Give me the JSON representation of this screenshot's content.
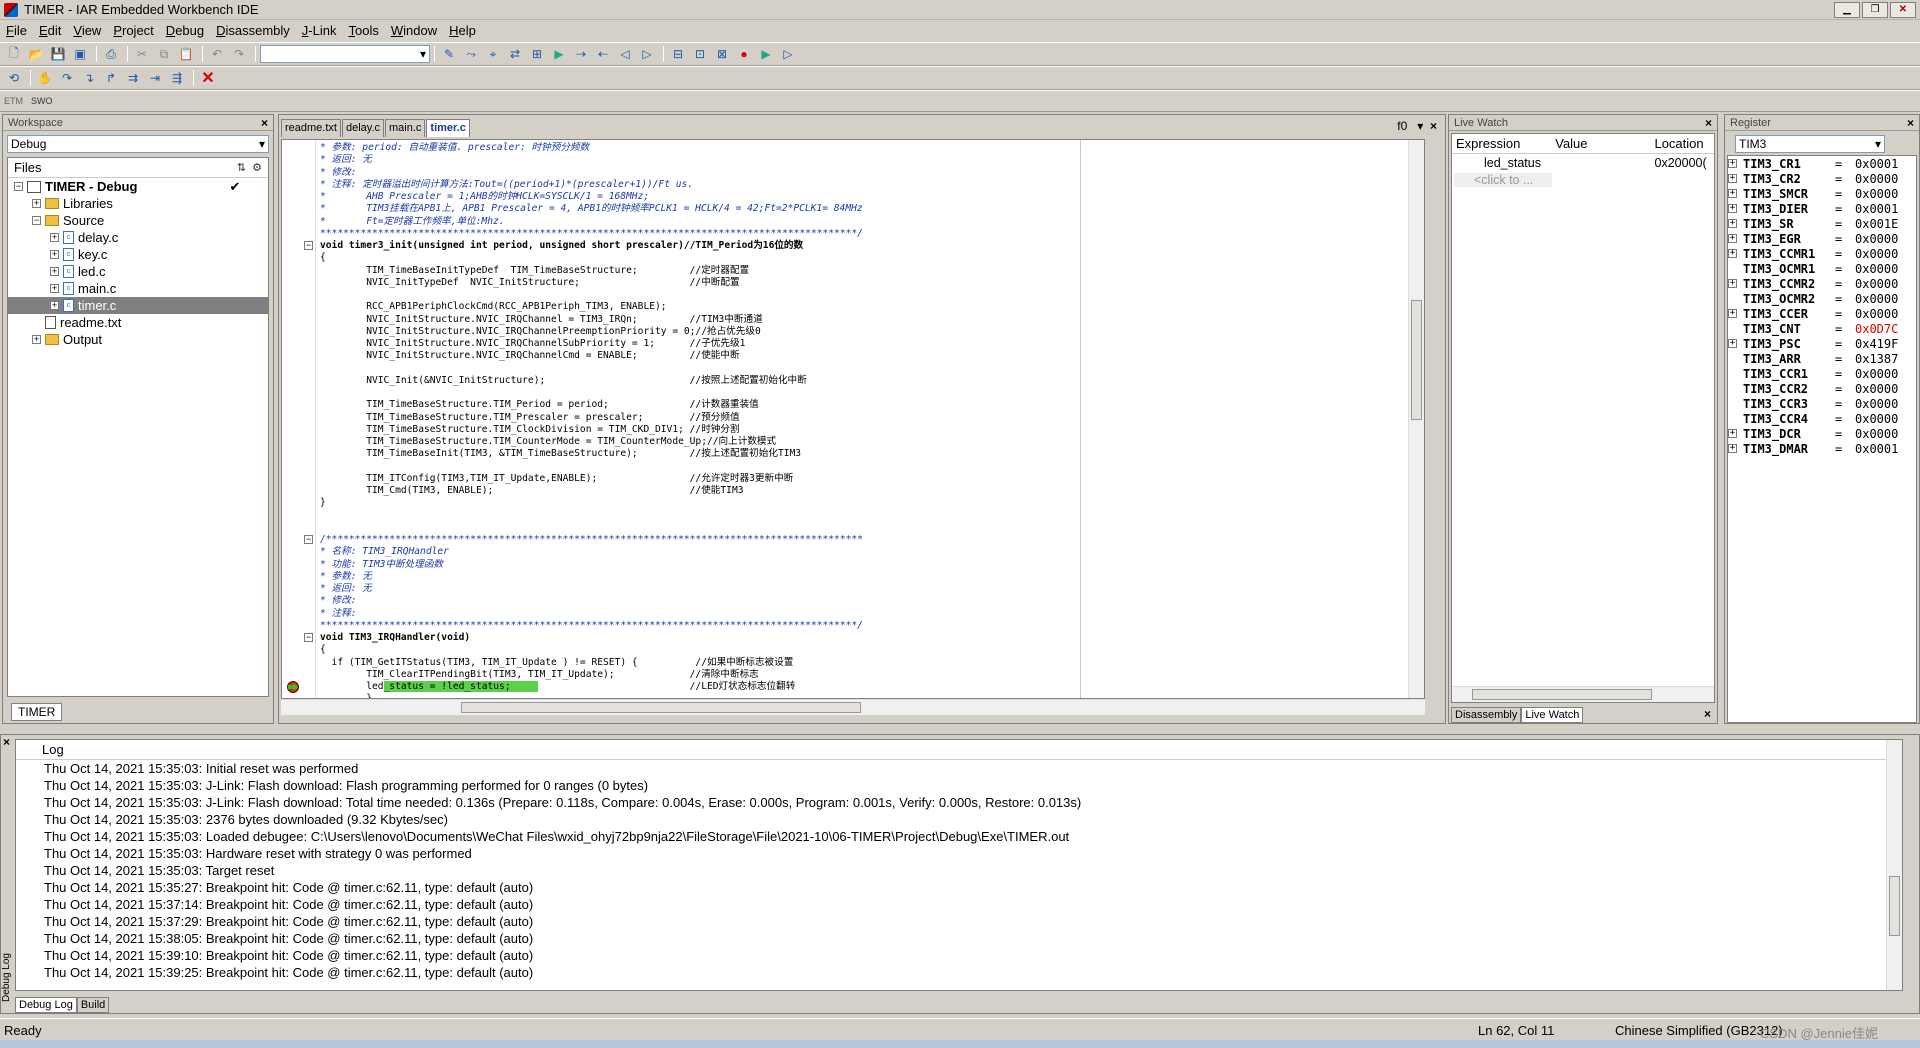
{
  "window": {
    "title": "TIMER - IAR Embedded Workbench IDE",
    "min": "▁",
    "max": "❐",
    "close": "✕"
  },
  "menu": [
    "File",
    "Edit",
    "View",
    "Project",
    "Debug",
    "Disassembly",
    "J-Link",
    "Tools",
    "Window",
    "Help"
  ],
  "toolbar_icons": [
    "new-file-icon",
    "open-file-icon",
    "save-icon",
    "save-all-icon",
    "print-icon",
    "cut-icon",
    "copy-icon",
    "paste-icon",
    "undo-icon",
    "redo-icon"
  ],
  "toolbar3_labels": {
    "etm": "ETM",
    "swo": "SWO"
  },
  "workspace": {
    "title": "Workspace",
    "close": "×",
    "config": "Debug",
    "files_header": "Files",
    "tree": [
      {
        "label": "TIMER - Debug",
        "level": 0,
        "type": "project",
        "bold": true
      },
      {
        "label": "Libraries",
        "level": 1,
        "type": "folder"
      },
      {
        "label": "Source",
        "level": 1,
        "type": "folder"
      },
      {
        "label": "delay.c",
        "level": 2,
        "type": "c"
      },
      {
        "label": "key.c",
        "level": 2,
        "type": "c"
      },
      {
        "label": "led.c",
        "level": 2,
        "type": "c"
      },
      {
        "label": "main.c",
        "level": 2,
        "type": "c"
      },
      {
        "label": "timer.c",
        "level": 2,
        "type": "c",
        "selected": true
      },
      {
        "label": "readme.txt",
        "level": 1,
        "type": "txt"
      },
      {
        "label": "Output",
        "level": 1,
        "type": "folder"
      }
    ],
    "tab": "TIMER"
  },
  "editor": {
    "tabs": [
      "readme.txt",
      "delay.c",
      "main.c",
      "timer.c"
    ],
    "active_tab": "timer.c",
    "func_label": "f0",
    "lines": [
      {
        "t": "* 参数: period: 自动重装值. prescaler: 时钟预分频数",
        "c": "cmt"
      },
      {
        "t": "* 返回: 无",
        "c": "cmt"
      },
      {
        "t": "* 修改:",
        "c": "cmt"
      },
      {
        "t": "* 注释: 定时器溢出时间计算方法:Tout=((period+1)*(prescaler+1))/Ft us.",
        "c": "cmt"
      },
      {
        "t": "*       AHB Prescaler = 1;AHB的时钟HCLK=SYSCLK/1 = 168MHz;",
        "c": "cmt"
      },
      {
        "t": "*       TIM3挂载在APB1上, APB1 Prescaler = 4, APB1的时钟频率PCLK1 = HCLK/4 = 42;Ft=2*PCLK1= 84MHz",
        "c": "cmt"
      },
      {
        "t": "*       Ft=定时器工作频率,单位:Mhz.",
        "c": "cmt"
      },
      {
        "t": "*********************************************************************************************/",
        "c": "cmt"
      },
      {
        "t": "void timer3_init(unsigned int period, unsigned short prescaler)//TIM_Period为16位的数",
        "c": "fn"
      },
      {
        "t": "{",
        "c": ""
      },
      {
        "t": "        TIM_TimeBaseInitTypeDef  TIM_TimeBaseStructure;         //定时器配置",
        "c": "mix"
      },
      {
        "t": "        NVIC_InitTypeDef  NVIC_InitStructure;                   //中断配置",
        "c": "mix"
      },
      {
        "t": "",
        "c": ""
      },
      {
        "t": "        RCC_APB1PeriphClockCmd(RCC_APB1Periph_TIM3, ENABLE);",
        "c": ""
      },
      {
        "t": "        NVIC_InitStructure.NVIC_IRQChannel = TIM3_IRQn;         //TIM3中断通道",
        "c": "mix"
      },
      {
        "t": "        NVIC_InitStructure.NVIC_IRQChannelPreemptionPriority = 0;//抢占优先级0",
        "c": "mix"
      },
      {
        "t": "        NVIC_InitStructure.NVIC_IRQChannelSubPriority = 1;      //子优先级1",
        "c": "mix"
      },
      {
        "t": "        NVIC_InitStructure.NVIC_IRQChannelCmd = ENABLE;         //使能中断",
        "c": "mix"
      },
      {
        "t": "",
        "c": ""
      },
      {
        "t": "        NVIC_Init(&NVIC_InitStructure);                         //按照上述配置初始化中断",
        "c": "mix"
      },
      {
        "t": "",
        "c": ""
      },
      {
        "t": "        TIM_TimeBaseStructure.TIM_Period = period;              //计数器重装值",
        "c": "mix"
      },
      {
        "t": "        TIM_TimeBaseStructure.TIM_Prescaler = prescaler;        //预分频值",
        "c": "mix"
      },
      {
        "t": "        TIM_TimeBaseStructure.TIM_ClockDivision = TIM_CKD_DIV1; //时钟分割",
        "c": "mix"
      },
      {
        "t": "        TIM_TimeBaseStructure.TIM_CounterMode = TIM_CounterMode_Up;//向上计数模式",
        "c": "mix"
      },
      {
        "t": "        TIM_TimeBaseInit(TIM3, &TIM_TimeBaseStructure);         //按上述配置初始化TIM3",
        "c": "mix"
      },
      {
        "t": "",
        "c": ""
      },
      {
        "t": "        TIM_ITConfig(TIM3,TIM_IT_Update,ENABLE);                //允许定时器3更新中断",
        "c": "mix"
      },
      {
        "t": "        TIM_Cmd(TIM3, ENABLE);                                  //使能TIM3",
        "c": "mix"
      },
      {
        "t": "}",
        "c": ""
      },
      {
        "t": "",
        "c": ""
      },
      {
        "t": "",
        "c": ""
      },
      {
        "t": "/*********************************************************************************************",
        "c": "cmt"
      },
      {
        "t": "* 名称: TIM3_IRQHandler",
        "c": "cmt"
      },
      {
        "t": "* 功能: TIM3中断处理函数",
        "c": "cmt"
      },
      {
        "t": "* 参数: 无",
        "c": "cmt"
      },
      {
        "t": "* 返回: 无",
        "c": "cmt"
      },
      {
        "t": "* 修改:",
        "c": "cmt"
      },
      {
        "t": "* 注释:",
        "c": "cmt"
      },
      {
        "t": "*********************************************************************************************/",
        "c": "cmt"
      },
      {
        "t": "void TIM3_IRQHandler(void)",
        "c": "fn"
      },
      {
        "t": "{",
        "c": ""
      },
      {
        "t": "  if (TIM_GetITStatus(TIM3, TIM_IT_Update ) != RESET) {          //如果中断标志被设置",
        "c": "mix"
      },
      {
        "t": "        TIM_ClearITPendingBit(TIM3, TIM_IT_Update);             //清除中断标志",
        "c": "mix"
      },
      {
        "t": "        led_status = !led_status;                               //LED灯状态标志位翻转",
        "c": "hl"
      },
      {
        "t": "        }",
        "c": ""
      },
      {
        "t": "",
        "c": ""
      },
      {
        "t": "}",
        "c": ""
      }
    ]
  },
  "livewatch": {
    "title": "Live Watch",
    "close": "×",
    "columns": [
      "Expression",
      "Value",
      "Location"
    ],
    "rows": [
      {
        "expr": "led_status",
        "value": "",
        "loc": "0x20000("
      },
      {
        "expr": "<click to ...",
        "value": "",
        "loc": ""
      }
    ],
    "tabs": [
      "Disassembly",
      "Live Watch"
    ],
    "active_tab": "Live Watch",
    "tab_close": "×"
  },
  "register": {
    "title": "Register",
    "close": "×",
    "selected": "TIM3",
    "rows": [
      {
        "name": "TIM3_CR1",
        "value": "0x0001",
        "expand": true
      },
      {
        "name": "TIM3_CR2",
        "value": "0x0000",
        "expand": true
      },
      {
        "name": "TIM3_SMCR",
        "value": "0x0000",
        "expand": true
      },
      {
        "name": "TIM3_DIER",
        "value": "0x0001",
        "expand": true
      },
      {
        "name": "TIM3_SR",
        "value": "0x001E",
        "expand": true
      },
      {
        "name": "TIM3_EGR",
        "value": "0x0000",
        "expand": true
      },
      {
        "name": "TIM3_CCMR1",
        "value": "0x0000",
        "expand": true
      },
      {
        "name": "TIM3_OCMR1",
        "value": "0x0000",
        "expand": false
      },
      {
        "name": "TIM3_CCMR2",
        "value": "0x0000",
        "expand": true
      },
      {
        "name": "TIM3_OCMR2",
        "value": "0x0000",
        "expand": false
      },
      {
        "name": "TIM3_CCER",
        "value": "0x0000",
        "expand": true
      },
      {
        "name": "TIM3_CNT",
        "value": "0x0D7C",
        "expand": false,
        "red": true
      },
      {
        "name": "TIM3_PSC",
        "value": "0x419F",
        "expand": true
      },
      {
        "name": "TIM3_ARR",
        "value": "0x1387",
        "expand": false
      },
      {
        "name": "TIM3_CCR1",
        "value": "0x0000",
        "expand": false
      },
      {
        "name": "TIM3_CCR2",
        "value": "0x0000",
        "expand": false
      },
      {
        "name": "TIM3_CCR3",
        "value": "0x0000",
        "expand": false
      },
      {
        "name": "TIM3_CCR4",
        "value": "0x0000",
        "expand": false
      },
      {
        "name": "TIM3_DCR",
        "value": "0x0000",
        "expand": true
      },
      {
        "name": "TIM3_DMAR",
        "value": "0x0001",
        "expand": true
      }
    ]
  },
  "log": {
    "header": "Log",
    "side_label": "Debug Log",
    "lines": [
      "Thu Oct 14, 2021 15:35:03: Initial reset was performed",
      "Thu Oct 14, 2021 15:35:03: J-Link: Flash download: Flash programming performed for 0 ranges (0 bytes)",
      "Thu Oct 14, 2021 15:35:03: J-Link: Flash download: Total time needed: 0.136s (Prepare: 0.118s, Compare: 0.004s, Erase: 0.000s, Program: 0.001s, Verify: 0.000s, Restore: 0.013s)",
      "Thu Oct 14, 2021 15:35:03: 2376 bytes downloaded (9.32 Kbytes/sec)",
      "Thu Oct 14, 2021 15:35:03: Loaded debugee: C:\\Users\\lenovo\\Documents\\WeChat Files\\wxid_ohyj72bp9nja22\\FileStorage\\File\\2021-10\\06-TIMER\\Project\\Debug\\Exe\\TIMER.out",
      "Thu Oct 14, 2021 15:35:03: Hardware reset with strategy 0 was performed",
      "Thu Oct 14, 2021 15:35:03: Target reset",
      "Thu Oct 14, 2021 15:35:27: Breakpoint hit: Code @ timer.c:62.11, type: default (auto)",
      "Thu Oct 14, 2021 15:37:14: Breakpoint hit: Code @ timer.c:62.11, type: default (auto)",
      "Thu Oct 14, 2021 15:37:29: Breakpoint hit: Code @ timer.c:62.11, type: default (auto)",
      "Thu Oct 14, 2021 15:38:05: Breakpoint hit: Code @ timer.c:62.11, type: default (auto)",
      "Thu Oct 14, 2021 15:39:10: Breakpoint hit: Code @ timer.c:62.11, type: default (auto)",
      "Thu Oct 14, 2021 15:39:25: Breakpoint hit: Code @ timer.c:62.11, type: default (auto)"
    ],
    "tabs": [
      "Debug Log",
      "Build"
    ],
    "active_tab": "Debug Log"
  },
  "status": {
    "left": "Ready",
    "pos": "Ln 62, Col 11",
    "encoding": "Chinese Simplified (GB2312)",
    "watermark": "CSDN @Jennie佳妮"
  }
}
